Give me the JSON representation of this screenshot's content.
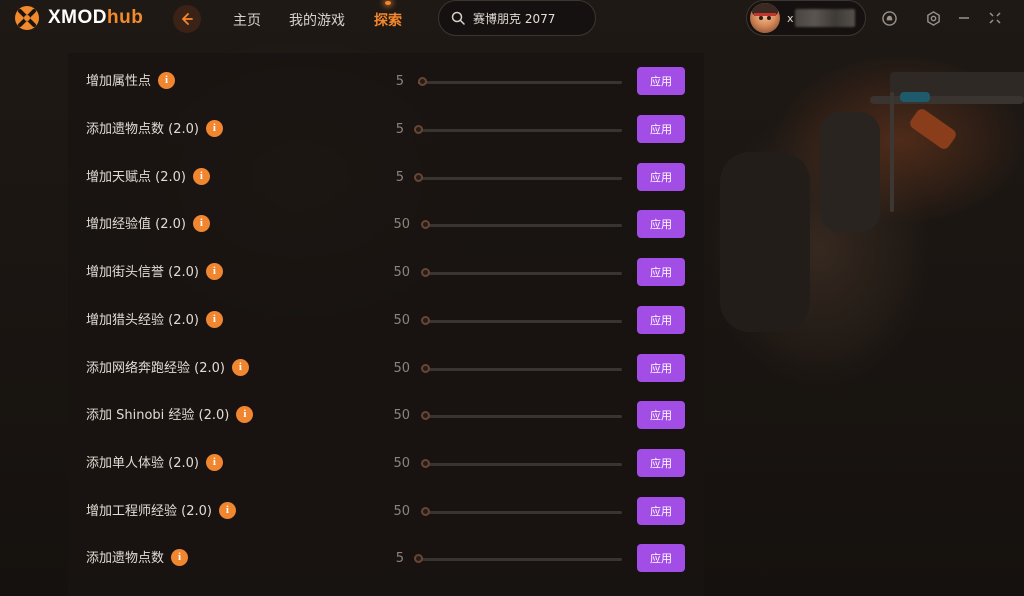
{
  "app": {
    "logo_prefix": "XMOD",
    "logo_suffix": "hub"
  },
  "nav": {
    "home": "主页",
    "my_games": "我的游戏",
    "explore": "探索"
  },
  "search": {
    "value": "赛博朋克 2077"
  },
  "user": {
    "name_visible": "x"
  },
  "colors": {
    "accent": "#f5872d",
    "apply_button": "#a24de6",
    "info_badge": "#f08630"
  },
  "options": [
    {
      "label": "增加属性点",
      "value": "5",
      "level": 0.02,
      "apply_label": "应用"
    },
    {
      "label": "添加遗物点数 (2.0)",
      "value": "5",
      "level": 0,
      "apply_label": "应用"
    },
    {
      "label": "增加天赋点 (2.0)",
      "value": "5",
      "level": 0,
      "apply_label": "应用"
    },
    {
      "label": "增加经验值 (2.0)",
      "value": "50",
      "level": 0,
      "apply_label": "应用"
    },
    {
      "label": "增加街头信誉 (2.0)",
      "value": "50",
      "level": 0,
      "apply_label": "应用"
    },
    {
      "label": "增加猎头经验 (2.0)",
      "value": "50",
      "level": 0,
      "apply_label": "应用"
    },
    {
      "label": "添加网络奔跑经验 (2.0)",
      "value": "50",
      "level": 0,
      "apply_label": "应用"
    },
    {
      "label": "添加 Shinobi 经验 (2.0)",
      "value": "50",
      "level": 0,
      "apply_label": "应用"
    },
    {
      "label": "添加单人体验 (2.0)",
      "value": "50",
      "level": 0,
      "apply_label": "应用"
    },
    {
      "label": "增加工程师经验 (2.0)",
      "value": "50",
      "level": 0,
      "apply_label": "应用"
    },
    {
      "label": "添加遗物点数",
      "value": "5",
      "level": 0,
      "apply_label": "应用"
    }
  ]
}
